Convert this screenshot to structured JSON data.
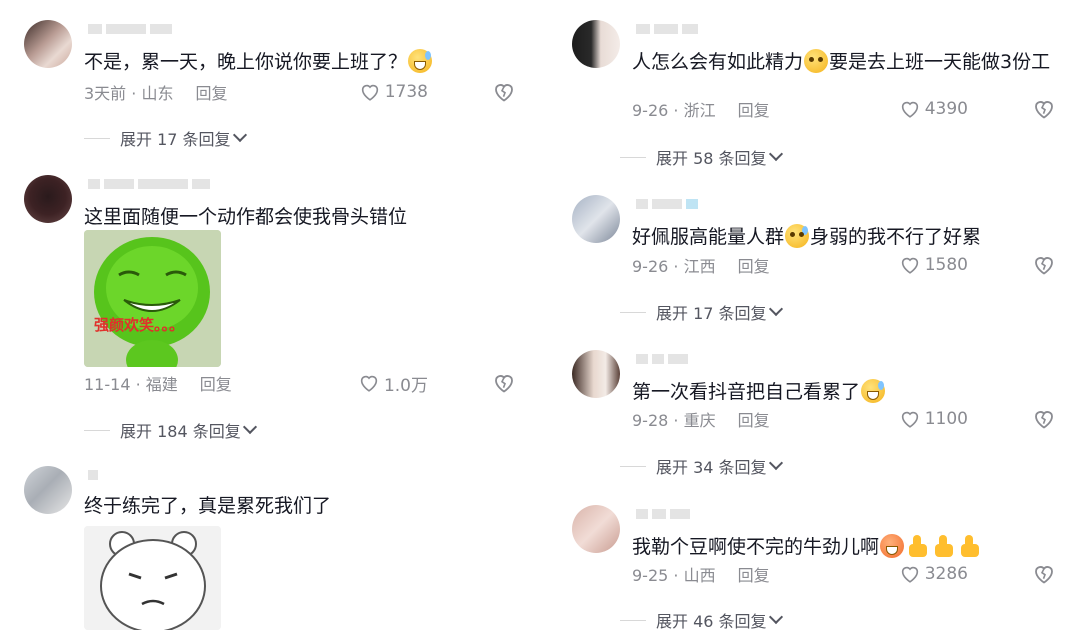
{
  "left": {
    "comments": [
      {
        "text": "不是，累一天，晚上你说你要上班了？",
        "meta_date": "3天前 · 山东",
        "reply": "回复",
        "likes": "1738",
        "expand": "展开 17 条回复"
      },
      {
        "text": "这里面随便一个动作都会使我骨头错位",
        "sticker_caption": "强颜欢笑。。。",
        "meta_date": "11-14 · 福建",
        "reply": "回复",
        "likes": "1.0万",
        "expand": "展开 184 条回复"
      },
      {
        "text": "终于练完了，真是累死我们了"
      }
    ]
  },
  "right": {
    "comments": [
      {
        "text_a": "人怎么会有如此精力",
        "text_b": "要是去上班一天能做3份工",
        "meta_date": "9-26 · 浙江",
        "reply": "回复",
        "likes": "4390",
        "expand": "展开 58 条回复"
      },
      {
        "text_a": "好佩服高能量人群",
        "text_b": "身弱的我不行了好累",
        "meta_date": "9-26 · 江西",
        "reply": "回复",
        "likes": "1580",
        "expand": "展开 17 条回复"
      },
      {
        "text": "第一次看抖音把自己看累了",
        "meta_date": "9-28 · 重庆",
        "reply": "回复",
        "likes": "1100",
        "expand": "展开 34 条回复"
      },
      {
        "text": "我勒个豆啊使不完的牛劲儿啊",
        "meta_date": "9-25 · 山西",
        "reply": "回复",
        "likes": "3286",
        "expand": "展开 46 条回复"
      }
    ]
  },
  "icons": {
    "like": "heart-outline-icon",
    "dislike": "broken-heart-icon",
    "expand": "chevron-down-icon"
  }
}
